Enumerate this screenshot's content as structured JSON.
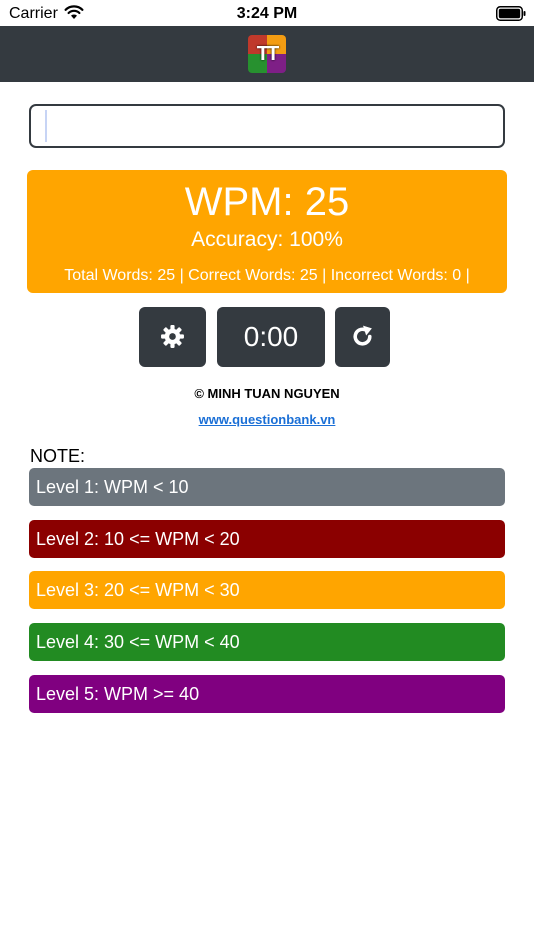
{
  "status_bar": {
    "carrier": "Carrier",
    "time": "3:24 PM"
  },
  "header": {
    "logo_text": "TT"
  },
  "input": {
    "value": "",
    "placeholder": ""
  },
  "results": {
    "wpm": "WPM: 25",
    "accuracy": "Accuracy: 100%",
    "word_stats": "Total Words: 25 | Correct Words: 25 | Incorrect Words: 0 |"
  },
  "controls": {
    "timer": "0:00"
  },
  "footer": {
    "copyright": "© MINH TUAN NGUYEN",
    "website": "www.questionbank.vn"
  },
  "note": {
    "title": "NOTE:",
    "levels": [
      {
        "label": "Level 1: WPM < 10",
        "color": "#6c757d"
      },
      {
        "label": "Level 2: 10 <= WPM < 20",
        "color": "#8b0000"
      },
      {
        "label": "Level 3: 20 <= WPM < 30",
        "color": "#ffa500"
      },
      {
        "label": "Level 4: 30 <= WPM < 40",
        "color": "#228b22"
      },
      {
        "label": "Level 5: WPM >= 40",
        "color": "#800080"
      }
    ]
  },
  "colors": {
    "header_bg": "#343a40",
    "result_bg": "#ffa500",
    "link": "#1a6fd6"
  },
  "icons": {
    "settings": "gear-icon",
    "reset": "refresh-icon",
    "wifi": "wifi-icon",
    "battery": "battery-icon"
  }
}
